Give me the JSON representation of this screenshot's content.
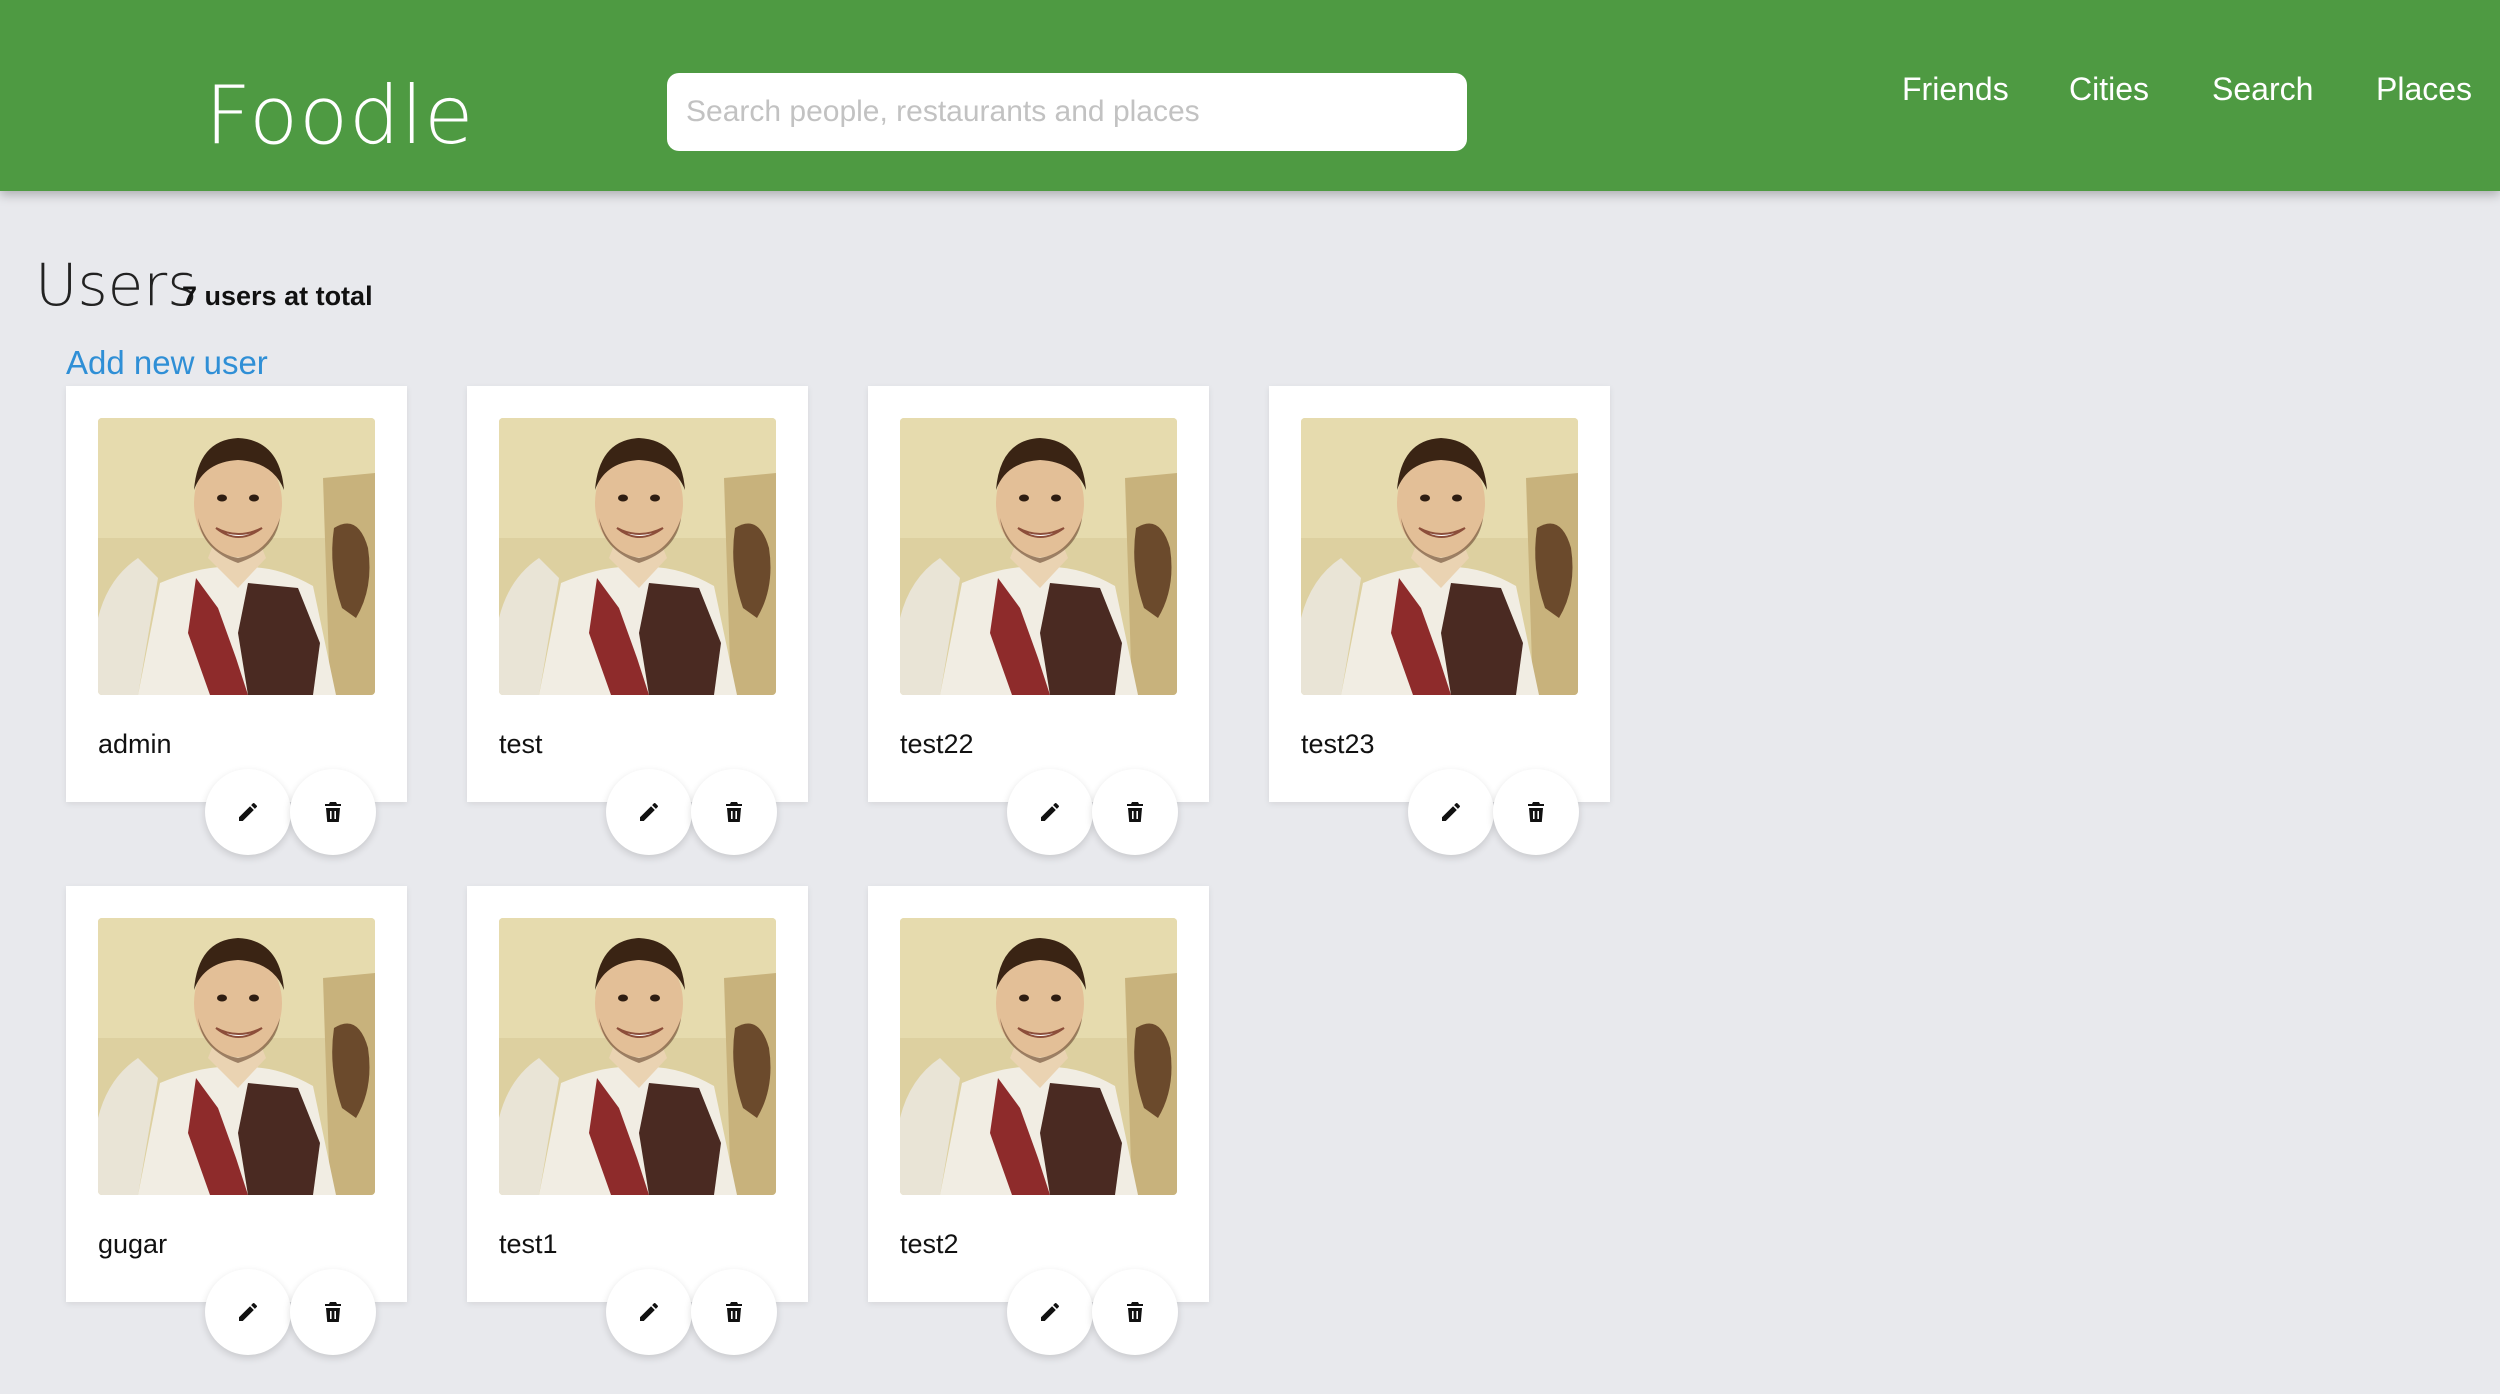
{
  "app": {
    "brand": "Foodle",
    "search": {
      "placeholder": "Search people, restaurants and places",
      "value": ""
    },
    "nav": [
      {
        "label": "Friends"
      },
      {
        "label": "Cities"
      },
      {
        "label": "Search"
      },
      {
        "label": "Places"
      }
    ]
  },
  "page": {
    "title": "Users",
    "subtitle": "7 users at total",
    "add_label": "Add new user"
  },
  "users": [
    {
      "name": "admin"
    },
    {
      "name": "test"
    },
    {
      "name": "test22"
    },
    {
      "name": "test23"
    },
    {
      "name": "gugar"
    },
    {
      "name": "test1"
    },
    {
      "name": "test2"
    }
  ],
  "icons": {
    "edit": "pencil-icon",
    "delete": "trash-icon"
  },
  "colors": {
    "navbar": "#4e9a42",
    "background": "#e8e9ed",
    "link": "#2f8fd6",
    "card": "#ffffff"
  }
}
